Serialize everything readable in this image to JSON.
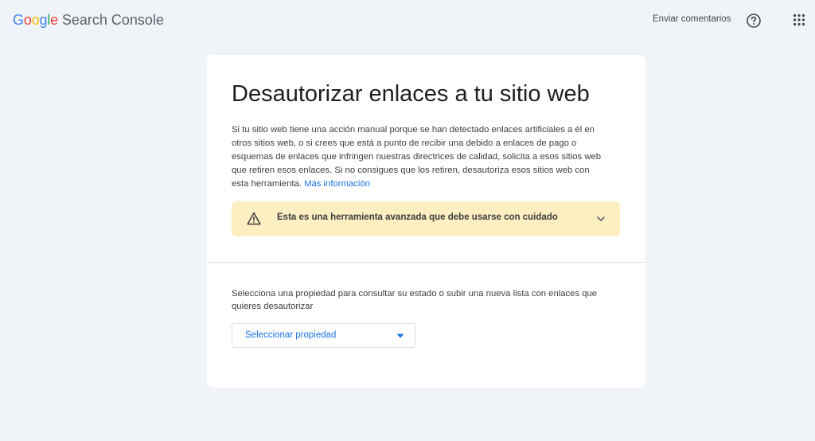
{
  "header": {
    "logo_letters": [
      "G",
      "o",
      "o",
      "g",
      "l",
      "e"
    ],
    "product_name": "Search Console",
    "feedback_label": "Enviar comentarios",
    "help_icon": "help-circle-icon",
    "apps_icon": "apps-grid-icon"
  },
  "main": {
    "title": "Desautorizar enlaces a tu sitio web",
    "description": "Si tu sitio web tiene una acción manual porque se han detectado enlaces artificiales a él en otros sitios web, o si crees que está a punto de recibir una debido a enlaces de pago o esquemas de enlaces que infringen nuestras directrices de calidad, solicita a esos sitios web que retiren esos enlaces. Si no consigues que los retiren, desautoriza esos sitios web con esta herramienta.",
    "learn_more_link": "Más información",
    "warning": {
      "text": "Esta es una herramienta avanzada que debe usarse con cuidado",
      "icon": "warning-triangle-icon",
      "expand_icon": "chevron-down-icon",
      "background_color": "#feefc3"
    },
    "property_prompt": "Selecciona una propiedad para consultar su estado o subir una nueva lista con enlaces que quieres desautorizar",
    "property_select": {
      "selected_value": "Seleccionar propiedad",
      "icon": "dropdown-caret-icon"
    }
  },
  "colors": {
    "page_background": "#f0f4f9",
    "card_background": "#ffffff",
    "accent_blue": "#1a73e8"
  }
}
